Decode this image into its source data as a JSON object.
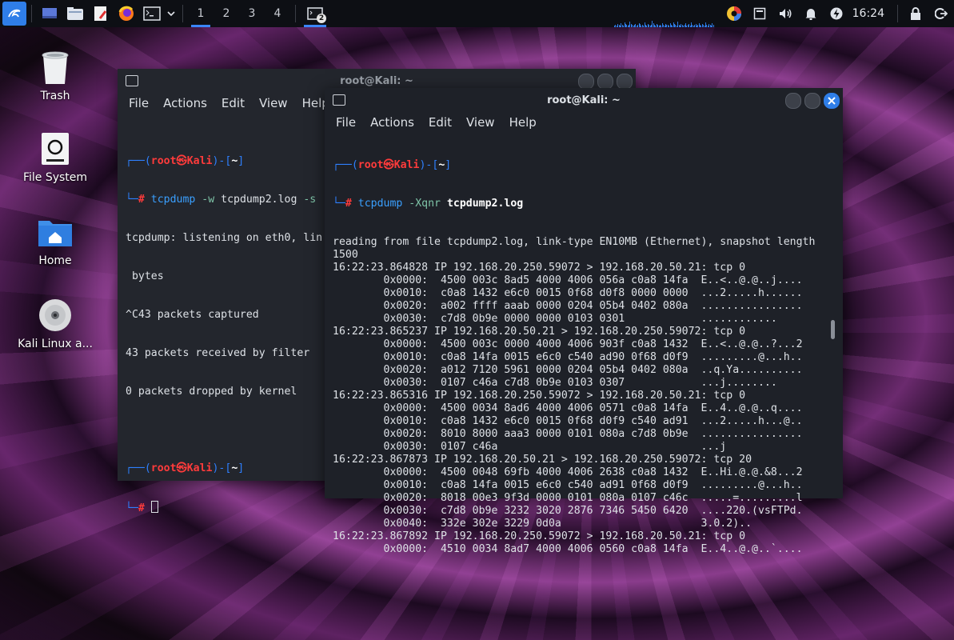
{
  "panel": {
    "workspaces": [
      "1",
      "2",
      "3",
      "4"
    ],
    "task_badge": "2",
    "clock": "16:24"
  },
  "desktop": {
    "icons": [
      {
        "label": "Trash"
      },
      {
        "label": "File System"
      },
      {
        "label": "Home"
      },
      {
        "label": "Kali Linux a..."
      }
    ]
  },
  "back_window": {
    "title": "root@Kali: ~",
    "menu": [
      "File",
      "Actions",
      "Edit",
      "View",
      "Help"
    ],
    "prompt_open": "┌──(",
    "prompt_user": "root㉿Kali",
    "prompt_mid": ")-[",
    "prompt_dir": "~",
    "prompt_close": "]",
    "prompt_line2": "└─",
    "prompt_hash": "# ",
    "command_name": "tcpdump",
    "command_args": " -w ",
    "command_rest": "tcpdump2.log ",
    "command_flag": "-s",
    "output": [
      "tcpdump: listening on eth0, lin",
      " bytes",
      "^C43 packets captured",
      "43 packets received by filter",
      "0 packets dropped by kernel"
    ]
  },
  "front_window": {
    "title": "root@Kali: ~",
    "menu": [
      "File",
      "Actions",
      "Edit",
      "View",
      "Help"
    ],
    "command_name": "tcpdump",
    "command_flag": " -Xqnr ",
    "command_file": "tcpdump2.log",
    "lines": [
      "reading from file tcpdump2.log, link-type EN10MB (Ethernet), snapshot length",
      "1500",
      "16:22:23.864828 IP 192.168.20.250.59072 > 192.168.20.50.21: tcp 0",
      "        0x0000:  4500 003c 8ad5 4000 4006 056a c0a8 14fa  E..<..@.@..j....",
      "        0x0010:  c0a8 1432 e6c0 0015 0f68 d0f8 0000 0000  ...2.....h......",
      "        0x0020:  a002 ffff aaab 0000 0204 05b4 0402 080a  ................",
      "        0x0030:  c7d8 0b9e 0000 0000 0103 0301            ............",
      "16:22:23.865237 IP 192.168.20.50.21 > 192.168.20.250.59072: tcp 0",
      "        0x0000:  4500 003c 0000 4000 4006 903f c0a8 1432  E..<..@.@..?...2",
      "        0x0010:  c0a8 14fa 0015 e6c0 c540 ad90 0f68 d0f9  .........@...h..",
      "        0x0020:  a012 7120 5961 0000 0204 05b4 0402 080a  ..q.Ya..........",
      "        0x0030:  0107 c46a c7d8 0b9e 0103 0307            ...j........",
      "16:22:23.865316 IP 192.168.20.250.59072 > 192.168.20.50.21: tcp 0",
      "        0x0000:  4500 0034 8ad6 4000 4006 0571 c0a8 14fa  E..4..@.@..q....",
      "        0x0010:  c0a8 1432 e6c0 0015 0f68 d0f9 c540 ad91  ...2.....h...@..",
      "        0x0020:  8010 8000 aaa3 0000 0101 080a c7d8 0b9e  ................",
      "        0x0030:  0107 c46a                                ...j",
      "16:22:23.867873 IP 192.168.20.50.21 > 192.168.20.250.59072: tcp 20",
      "        0x0000:  4500 0048 69fb 4000 4006 2638 c0a8 1432  E..Hi.@.@.&8...2",
      "        0x0010:  c0a8 14fa 0015 e6c0 c540 ad91 0f68 d0f9  .........@...h..",
      "        0x0020:  8018 00e3 9f3d 0000 0101 080a 0107 c46c  .....=.........l",
      "        0x0030:  c7d8 0b9e 3232 3020 2876 7346 5450 6420  ....220.(vsFTPd.",
      "        0x0040:  332e 302e 3229 0d0a                      3.0.2)..",
      "16:22:23.867892 IP 192.168.20.250.59072 > 192.168.20.50.21: tcp 0",
      "        0x0000:  4510 0034 8ad7 4000 4006 0560 c0a8 14fa  E..4..@.@..`...."
    ]
  }
}
